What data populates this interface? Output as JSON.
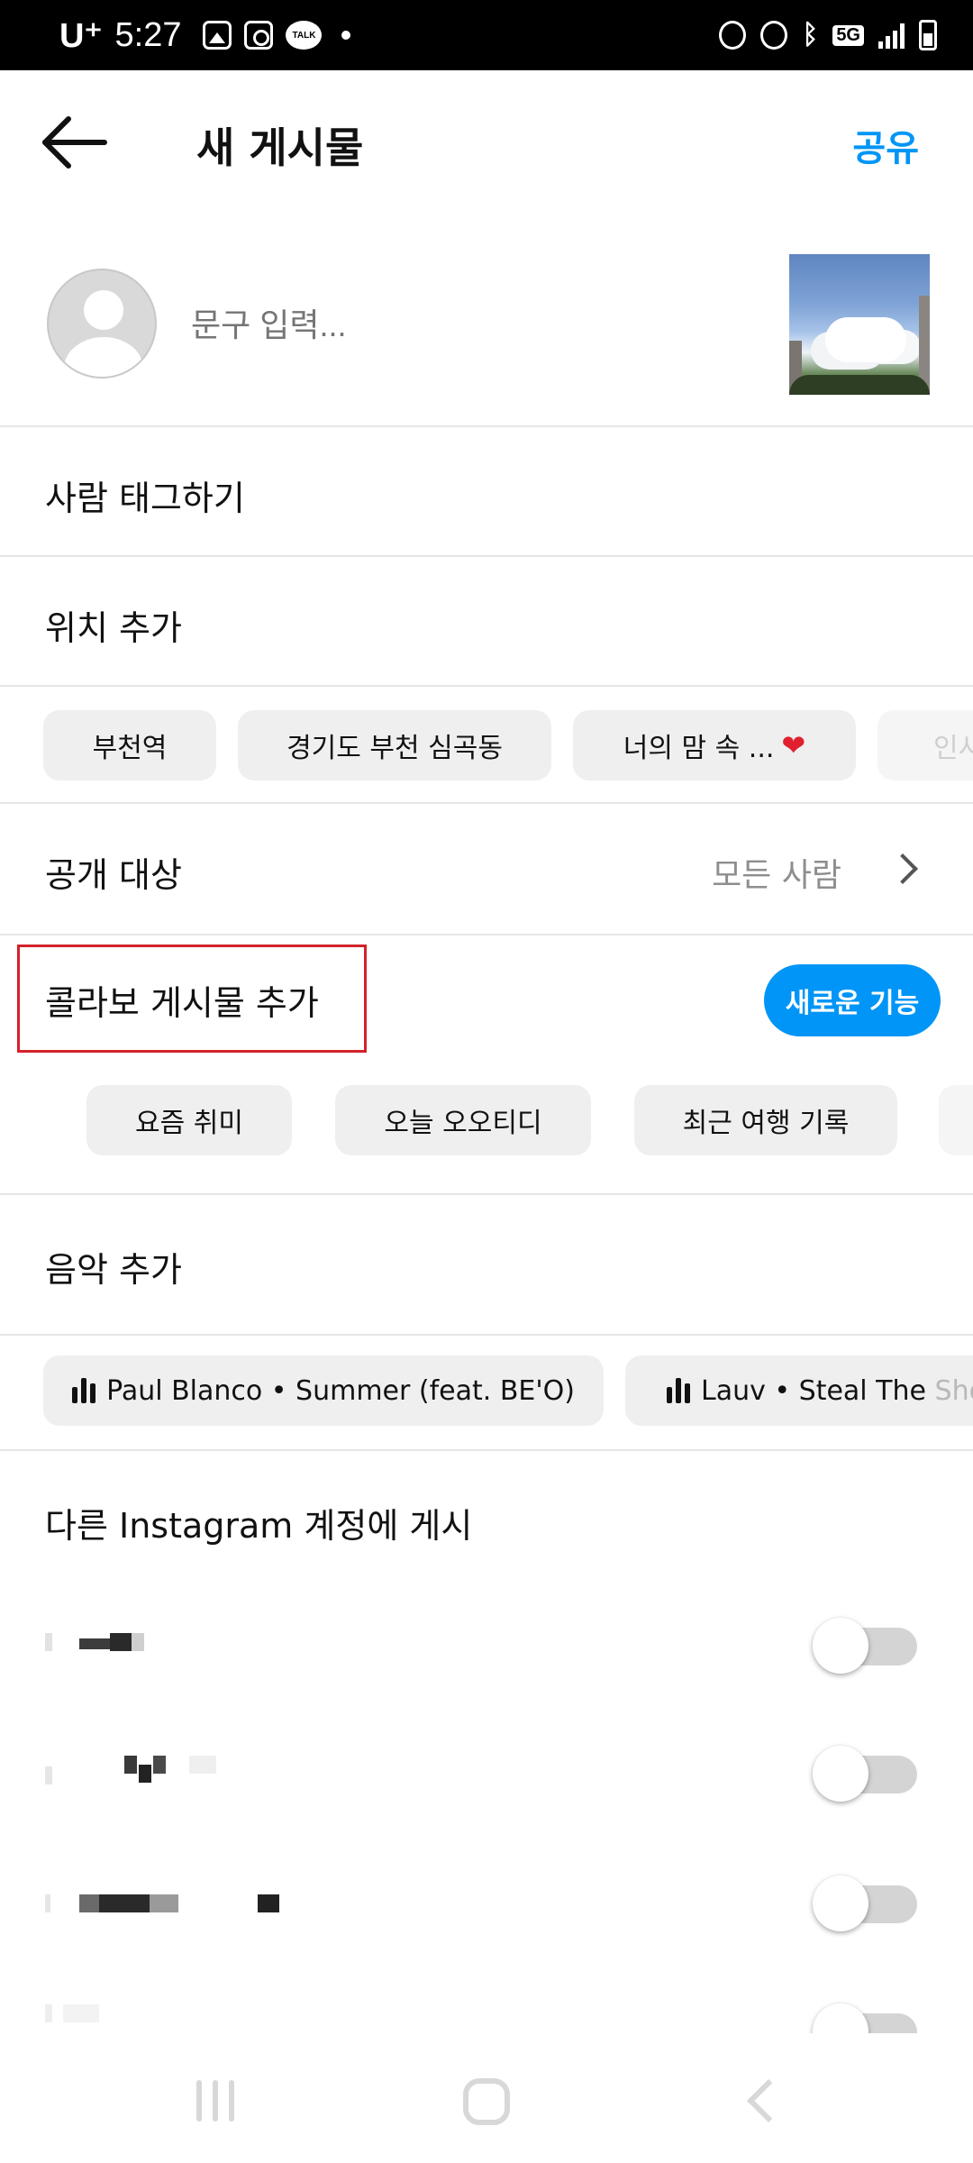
{
  "status_bar": {
    "carrier": "U⁺",
    "time": "5:27",
    "talk_icon_text": "TALK",
    "network": "5G",
    "icons": [
      "gallery-icon",
      "instagram-icon",
      "kakaotalk-icon",
      "dot-icon",
      "battery-saver-icon",
      "alarm-icon",
      "bluetooth-icon",
      "5g-icon",
      "signal-icon",
      "battery-icon"
    ]
  },
  "header": {
    "back_icon": "arrow-left-icon",
    "title": "새 게시물",
    "share_label": "공유",
    "accent_color": "#0095f6"
  },
  "caption": {
    "placeholder": "문구 입력..."
  },
  "menu": {
    "tag_people": "사람 태그하기",
    "add_location": "위치 추가",
    "audience_label": "공개 대상",
    "audience_value": "모든 사람",
    "collab_label": "콜라보 게시물 추가",
    "new_feature_badge": "새로운 기능",
    "add_music": "음악 추가",
    "post_to_other": "다른 Instagram 계정에 게시"
  },
  "location_chips": [
    {
      "label": "부천역"
    },
    {
      "label": "경기도 부천 심곡동"
    },
    {
      "label": "너의 맘 속 ..."
    },
    {
      "label": "인사"
    }
  ],
  "collab_chips": [
    {
      "label": "요즘 취미"
    },
    {
      "label": "오늘 오오티디"
    },
    {
      "label": "최근 여행 기록"
    }
  ],
  "music_chips": [
    {
      "artist": "Paul Blanco",
      "song": "Summer (feat. BE'O)",
      "separator": " • "
    },
    {
      "artist": "Lauv",
      "song_visible": "Steal The",
      "song_faded": " Sho",
      "separator": " • "
    }
  ],
  "accounts": [
    {
      "enabled": false
    },
    {
      "enabled": false
    },
    {
      "enabled": false
    },
    {
      "enabled": false
    }
  ],
  "colors": {
    "highlight_box": "#d3222a",
    "heart": "#e0202e"
  }
}
